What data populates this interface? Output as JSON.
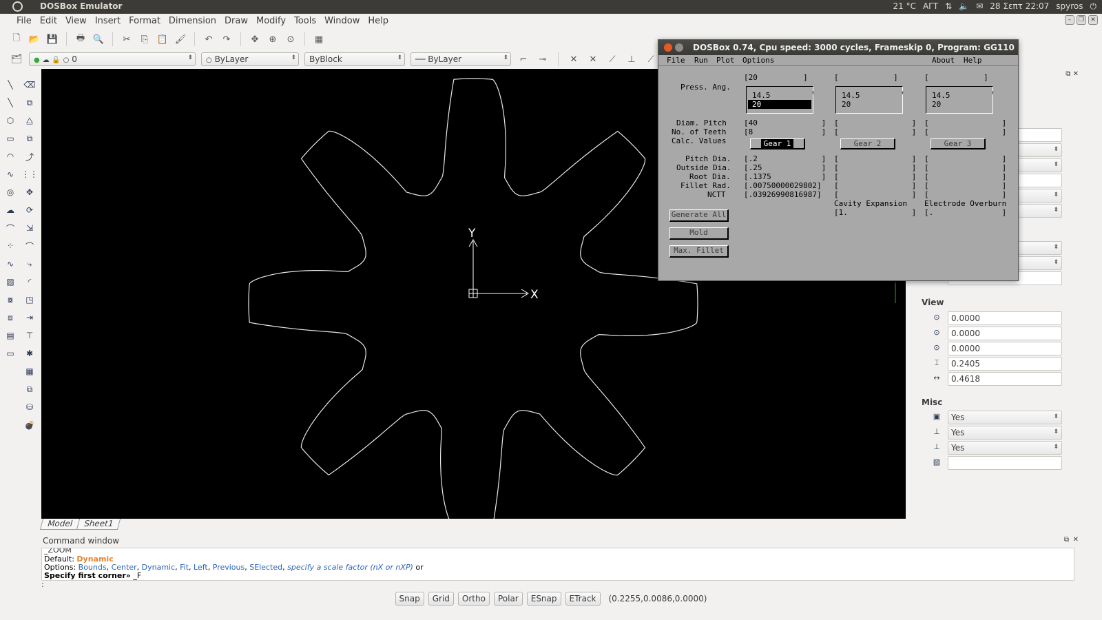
{
  "topbar": {
    "title": "DOSBox Emulator",
    "tray": [
      "21 °C",
      "ΑΓΤ",
      "28 Σεπτ 22:07",
      "spyros"
    ]
  },
  "menu": [
    "File",
    "Edit",
    "View",
    "Insert",
    "Format",
    "Dimension",
    "Draw",
    "Modify",
    "Tools",
    "Window",
    "Help"
  ],
  "layers": {
    "layer_value": "0",
    "color": "ByLayer",
    "linetype": "ByBlock",
    "lineweight": "ByLayer"
  },
  "canvas": {
    "axis_x": "X",
    "axis_y": "Y"
  },
  "tabs": [
    "Model",
    "Sheet1"
  ],
  "command": {
    "header": "Command window",
    "line0": "_ZOOM",
    "default_label": "Default:",
    "default_value": "Dynamic",
    "options_label": "Options:",
    "options": [
      "Bounds",
      "Center",
      "Dynamic",
      "Fit",
      "Left",
      "Previous",
      "SElected"
    ],
    "options_tail": "specify a scale factor (nX or nXP)",
    "or": "or",
    "specify": "Specify first corner»",
    "specify_tail": "_F",
    "prompt": ":"
  },
  "status": {
    "buttons": [
      "Snap",
      "Grid",
      "Ortho",
      "Polar",
      "ESnap",
      "ETrack"
    ],
    "coords": "(0.2255,0.0086,0.0000)"
  },
  "rightpanel": {
    "partial_value": "None",
    "view_title": "View",
    "view": [
      "0.0000",
      "0.0000",
      "0.0000",
      "0.2405",
      "0.4618"
    ],
    "misc_title": "Misc",
    "misc": [
      "Yes",
      "Yes",
      "Yes",
      ""
    ]
  },
  "dosbox": {
    "title": "DOSBox 0.74, Cpu speed:    3000 cycles, Frameskip  0, Program:   GG110",
    "menu_left": [
      "File",
      "Run",
      "Plot",
      "Options"
    ],
    "menu_right": [
      "About",
      "Help"
    ],
    "labels": {
      "press_ang": "Press. Ang.",
      "diam_pitch": "Diam. Pitch",
      "no_teeth": "No. of Teeth",
      "calc_values": "Calc. Values",
      "pitch_dia": "Pitch Dia.",
      "outside_dia": "Outside Dia.",
      "root_dia": "Root Dia.",
      "fillet_rad": "Fillet Rad.",
      "nctt": "NCTT",
      "cavity": "Cavity Expansion",
      "electrode": "Electrode Overburn"
    },
    "gear1": {
      "press_ang": "[20          ]",
      "list": [
        "14.5",
        "20"
      ],
      "diam_pitch": "[40              ]",
      "teeth": "[8               ]",
      "button": "Gear 1",
      "pitch_dia": "[.2              ]",
      "outside_dia": "[.25             ]",
      "root_dia": "[.1375           ]",
      "fillet_rad": "[.00750000029802]",
      "nctt": "[.03926990816987]"
    },
    "gear2": {
      "press_ang": "[            ]",
      "list": [
        "14.5",
        "20"
      ],
      "diam_pitch": "[                ]",
      "teeth": "[                ]",
      "button": "Gear 2",
      "blank": "[                ]",
      "cavity": "[1.              ]"
    },
    "gear3": {
      "press_ang": "[            ]",
      "list": [
        "14.5",
        "20"
      ],
      "diam_pitch": "[                ]",
      "teeth": "[                ]",
      "button": "Gear 3",
      "blank": "[                ]",
      "electrode": "[.               ]"
    },
    "buttons": [
      "Generate All",
      "Mold",
      "Max. Fillet"
    ]
  }
}
